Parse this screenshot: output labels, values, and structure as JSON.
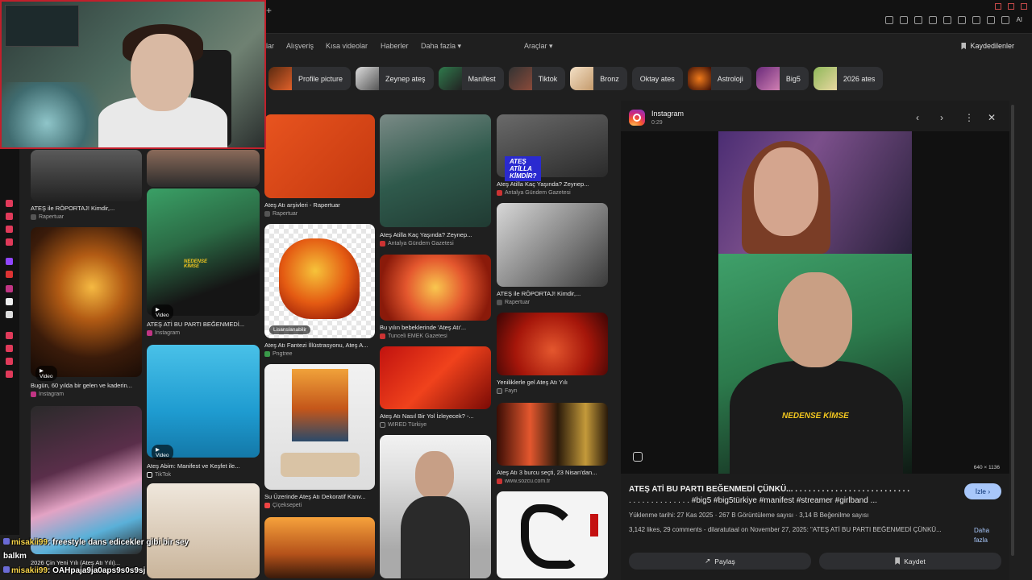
{
  "browser": {
    "new_tab_glyph": "+",
    "ai_label": "AI"
  },
  "nav": {
    "items": [
      "lar",
      "Alışveriş",
      "Kısa videolar",
      "Haberler",
      "Daha fazla ▾",
      "Araçlar ▾"
    ],
    "saved": "Kaydedilenler"
  },
  "chips": [
    "Profile picture",
    "Zeynep ateş",
    "Manifest",
    "Tiktok",
    "Bronz",
    "Oktay ates",
    "Astroloji",
    "Big5",
    "2026 ates"
  ],
  "grid": {
    "c1a_cap": "ATEŞ ile RÖPORTAJ! Kimdir,...",
    "c1a_src": "Rapertuar",
    "c1b_cap": "Bugün, 60 yılda bir gelen ve kaderin...",
    "c1b_src": "Instagram",
    "c1c_cap": "2026 Çin Yeni Yılı (Ateş Atı Yılı)...",
    "c2b_cap": "ATEŞ ATİ BU PARTI BEĞENMEDİ...",
    "c2b_src": "Instagram",
    "c2c_cap": "Ateş Abim: Manifest ve Keşfet ile...",
    "c2c_src": "TikTok",
    "c3a_cap": "Ateş Atı arşivleri - Rapertuar",
    "c3a_src": "Rapertuar",
    "c3b_cap": "Ateş Atı Fantezi İllüstrasyonu, Ateş A...",
    "c3b_src": "Pngtree",
    "c3c_cap": "Su Üzerinde Ateş Atı Dekoratif Kanv...",
    "c3c_src": "Çiçeksepeti",
    "c4a_cap": "Ateş Atilla Kaç Yaşında? Zeynep...",
    "c4a_src": "Antalya Gündem Gazetesi",
    "c4b_cap": "Bu yılın bebeklerinde 'Ateş Atı'...",
    "c4b_src": "Tunceli EMEK Gazetesi",
    "c4c_cap": "Ateş Atı Nasıl Bir Yol İzleyecek? -...",
    "c4c_src": "WIRED Türkiye",
    "c5a_cap": "Ateş Atilla Kaç Yaşında? Zeynep...",
    "c5a_src": "Antalya Gündem Gazetesi",
    "c5a_overlay": "ATEŞ ATİLLA KİMDİR?",
    "c5b_cap": "ATEŞ ile RÖPORTAJ! Kimdir,...",
    "c5b_src": "Rapertuar",
    "c5c_cap": "Yeniliklerle gel Ateş Atı Yılı",
    "c5c_src": "Fayn",
    "c5d_cap": "Ateş Atı 3 burcu seçti, 23 Nisan'dan...",
    "c5d_src": "www.sozcu.com.tr",
    "video_badge": "▶ Video",
    "license_badge": "Lisanslanabilir",
    "shirt_text": "NEDENSE KİMSE"
  },
  "viewer": {
    "source": "Instagram",
    "duration": "0:29",
    "prev": "‹",
    "next": "›",
    "menu": "⋮",
    "close": "✕",
    "dims": "640 × 1136",
    "shirt_text": "NEDENSE KİMSE",
    "title": "ATEŞ ATİ BU PARTI BEĞENMEDİ ÇÜNKÜ... . . . . . . . . . . . . . . . . . . . . . . . . . .",
    "title_tags": ". . . . . . . . . . . . . . #big5 #big5türkiye #manifest #streamer #girlband ...",
    "watch": "İzle ›",
    "meta": "Yüklenme tarihi: 27 Kas 2025 · 267 B Görüntüleme sayısı · 3,14 B Beğenilme sayısı",
    "desc": "3,142 likes, 29 comments - dilaratutaal on November 27, 2025: \"ATEŞ ATİ BU PARTI BEĞENMEDİ ÇÜNKÜ...",
    "more": "Daha fazla",
    "share": "Paylaş",
    "save": "Kaydet"
  },
  "chat": [
    {
      "user": "misakii99",
      "text": ": freestyle dans edicekler gibi bir sey"
    },
    {
      "user": "",
      "text": "balkm"
    },
    {
      "user": "misakii99",
      "text": ": OAHpaja9ja0aps9s0s9sj"
    }
  ],
  "colors": {
    "accent": "#a8c7fa",
    "stream_border": "#c21f2b",
    "chat_name": "#f7d44a"
  }
}
